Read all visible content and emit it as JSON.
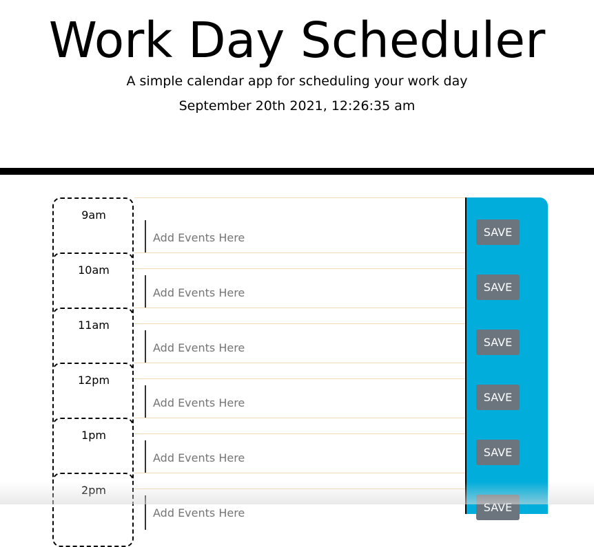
{
  "header": {
    "title": "Work Day Scheduler",
    "subtitle": "A simple calendar app for scheduling your work day",
    "datetime": "September 20th 2021, 12:26:35 am"
  },
  "colors": {
    "save_column": "#00ADDB",
    "save_button": "#6c757d",
    "rule": "#000000"
  },
  "rows": [
    {
      "hour": "9am",
      "placeholder": "Add Events Here",
      "save_label": "SAVE"
    },
    {
      "hour": "10am",
      "placeholder": "Add Events Here",
      "save_label": "SAVE"
    },
    {
      "hour": "11am",
      "placeholder": "Add Events Here",
      "save_label": "SAVE"
    },
    {
      "hour": "12pm",
      "placeholder": "Add Events Here",
      "save_label": "SAVE"
    },
    {
      "hour": "1pm",
      "placeholder": "Add Events Here",
      "save_label": "SAVE"
    },
    {
      "hour": "2pm",
      "placeholder": "Add Events Here",
      "save_label": "SAVE"
    }
  ]
}
